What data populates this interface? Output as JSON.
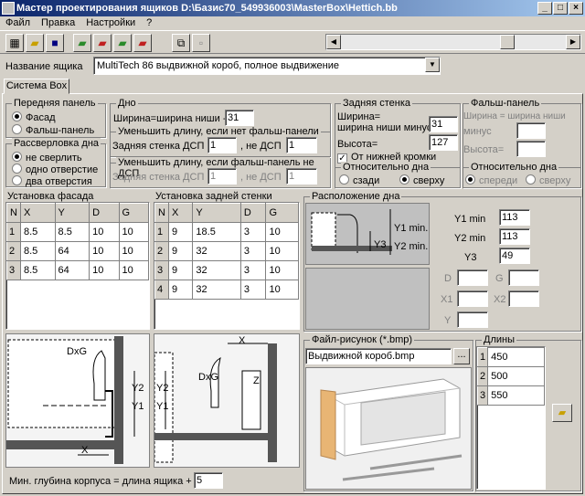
{
  "window": {
    "title": "Мастер проектирования ящиков  D:\\Базис70_549936003\\MasterBox\\Hettich.bb"
  },
  "menu": [
    "Файл",
    "Правка",
    "Настройки",
    "?"
  ],
  "box_name": {
    "label": "Название ящика",
    "value": "MultiTech 86 выдвижной короб, полное выдвижение"
  },
  "tab": "Система Box",
  "front_panel": {
    "title": "Передняя панель",
    "opt1": "Фасад",
    "opt2": "Фальш-панель",
    "selected": "Фасад"
  },
  "bottom_drilling": {
    "title": "Рассверловка дна",
    "opt1": "не сверлить",
    "opt2": "одно отверстие",
    "opt3": "два отверстия",
    "selected": "не сверлить"
  },
  "bottom": {
    "title": "Дно",
    "width_label": "Ширина=ширина ниши -",
    "width_value": "31",
    "reduce1_title": "Уменьшить длину, если нет фальш-панели",
    "reduce1_label_a": "Задняя стенка ДСП",
    "reduce1_val_a": "1",
    "reduce1_label_b": ", не ДСП",
    "reduce1_val_b": "1",
    "reduce2_title": "Уменьшить длину, если фальш-панель не ДСП",
    "reduce2_label_a": "Задняя стенка ДСП",
    "reduce2_val_a": "1",
    "reduce2_label_b": ", не ДСП",
    "reduce2_val_b": "1"
  },
  "back_wall": {
    "title": "Задняя стенка",
    "width_label": "Ширина=\nширина ниши минус",
    "width_label_1": "Ширина=",
    "width_label_2": "ширина ниши минус",
    "width_value": "31",
    "height_label": "Высота=",
    "height_value": "127",
    "from_edge": "От нижней кромки",
    "relative_title": "Относительно дна",
    "rel_opt1": "сзади",
    "rel_opt2": "сверху",
    "rel_selected": "сверху"
  },
  "false_panel": {
    "title": "Фальш-панель",
    "width_label": "Ширина = ширина ниши",
    "minus_label": "минус",
    "height_label": "Высота=",
    "relative_title": "Относительно дна",
    "rel_opt1": "спереди",
    "rel_opt2": "сверху"
  },
  "facade_mount": {
    "title": "Установка фасада",
    "headers": [
      "N",
      "X",
      "Y",
      "D",
      "G"
    ],
    "rows": [
      [
        "1",
        "8.5",
        "8.5",
        "10",
        "10"
      ],
      [
        "2",
        "8.5",
        "64",
        "10",
        "10"
      ],
      [
        "3",
        "8.5",
        "64",
        "10",
        "10"
      ]
    ]
  },
  "backwall_mount": {
    "title": "Установка задней стенки",
    "headers": [
      "N",
      "X",
      "Y",
      "D",
      "G"
    ],
    "rows": [
      [
        "1",
        "9",
        "18.5",
        "3",
        "10"
      ],
      [
        "2",
        "9",
        "32",
        "3",
        "10"
      ],
      [
        "3",
        "9",
        "32",
        "3",
        "10"
      ],
      [
        "4",
        "9",
        "32",
        "3",
        "10"
      ]
    ]
  },
  "bottom_position": {
    "title": "Расположение дна",
    "y1_label": "Y1 min",
    "y1_value": "113",
    "y2_label": "Y2 min",
    "y2_value": "113",
    "y3_label": "Y3",
    "y3_value": "49",
    "diagram_labels": {
      "y1": "Y1 min.",
      "y2": "Y2 min.",
      "y3": "Y3"
    },
    "d_label": "D",
    "g_label": "G",
    "x1_label": "X1",
    "x2_label": "X2",
    "y_label": "Y"
  },
  "drawings": {
    "facade": {
      "dxg": "DxG",
      "y2": "Y2",
      "y1": "Y1",
      "x": "X"
    },
    "back": {
      "x": "X",
      "y2": "Y2",
      "y1": "Y1",
      "dxg": "DxG",
      "z": "Z"
    }
  },
  "image_file": {
    "title": "Файл-рисунок (*.bmp)",
    "value": "Выдвижной короб.bmp",
    "browse": "..."
  },
  "lengths": {
    "title": "Длины",
    "rows": [
      [
        "1",
        "450"
      ],
      [
        "2",
        "500"
      ],
      [
        "3",
        "550"
      ]
    ]
  },
  "min_depth": {
    "label": "Мин. глубина корпуса = длина ящика +",
    "value": "5"
  }
}
